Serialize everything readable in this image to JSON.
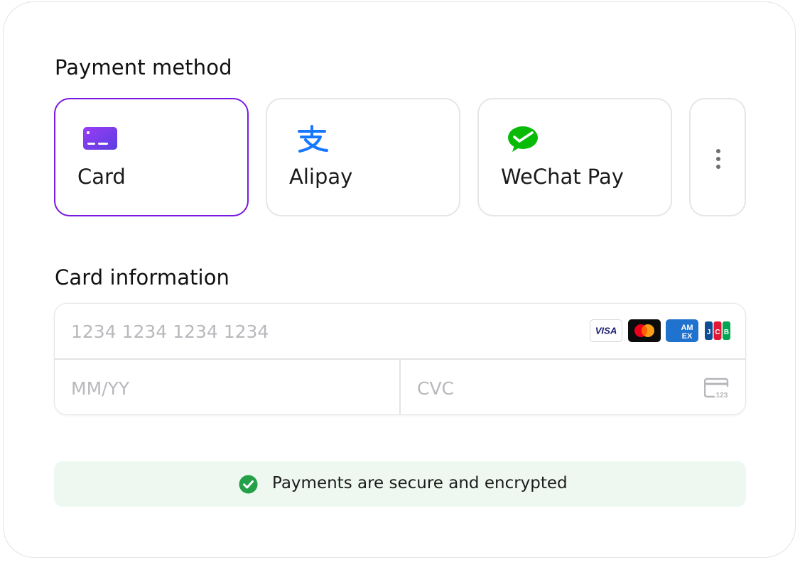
{
  "payment_method": {
    "title": "Payment method",
    "tabs": [
      {
        "label": "Card",
        "icon": "card-icon",
        "selected": true
      },
      {
        "label": "Alipay",
        "icon": "alipay-icon",
        "selected": false
      },
      {
        "label": "WeChat Pay",
        "icon": "wechat-pay-icon",
        "selected": false
      },
      {
        "label": "",
        "icon": "more-vertical-icon",
        "selected": false
      }
    ]
  },
  "card_information": {
    "title": "Card information",
    "card_number": {
      "value": "",
      "placeholder": "1234 1234 1234 1234"
    },
    "expiry": {
      "value": "",
      "placeholder": "MM/YY"
    },
    "cvc": {
      "value": "",
      "placeholder": "CVC"
    },
    "brands": [
      {
        "name": "Visa",
        "icon": "visa-icon",
        "text": "VISA"
      },
      {
        "name": "Mastercard",
        "icon": "mastercard-icon",
        "text": ""
      },
      {
        "name": "American Express",
        "icon": "amex-icon",
        "text": "AM EX"
      },
      {
        "name": "JCB",
        "icon": "jcb-icon",
        "text": "JCB"
      }
    ],
    "cvc_icon_text": "123"
  },
  "secure_notice": {
    "text": "Payments are secure and encrypted",
    "icon": "check-circle-icon"
  },
  "colors": {
    "accent": "#7a18e0",
    "alipay_blue": "#1677ff",
    "wechat_green": "#09bb07",
    "success_green": "#24a148",
    "banner_bg": "#eef8f1"
  }
}
